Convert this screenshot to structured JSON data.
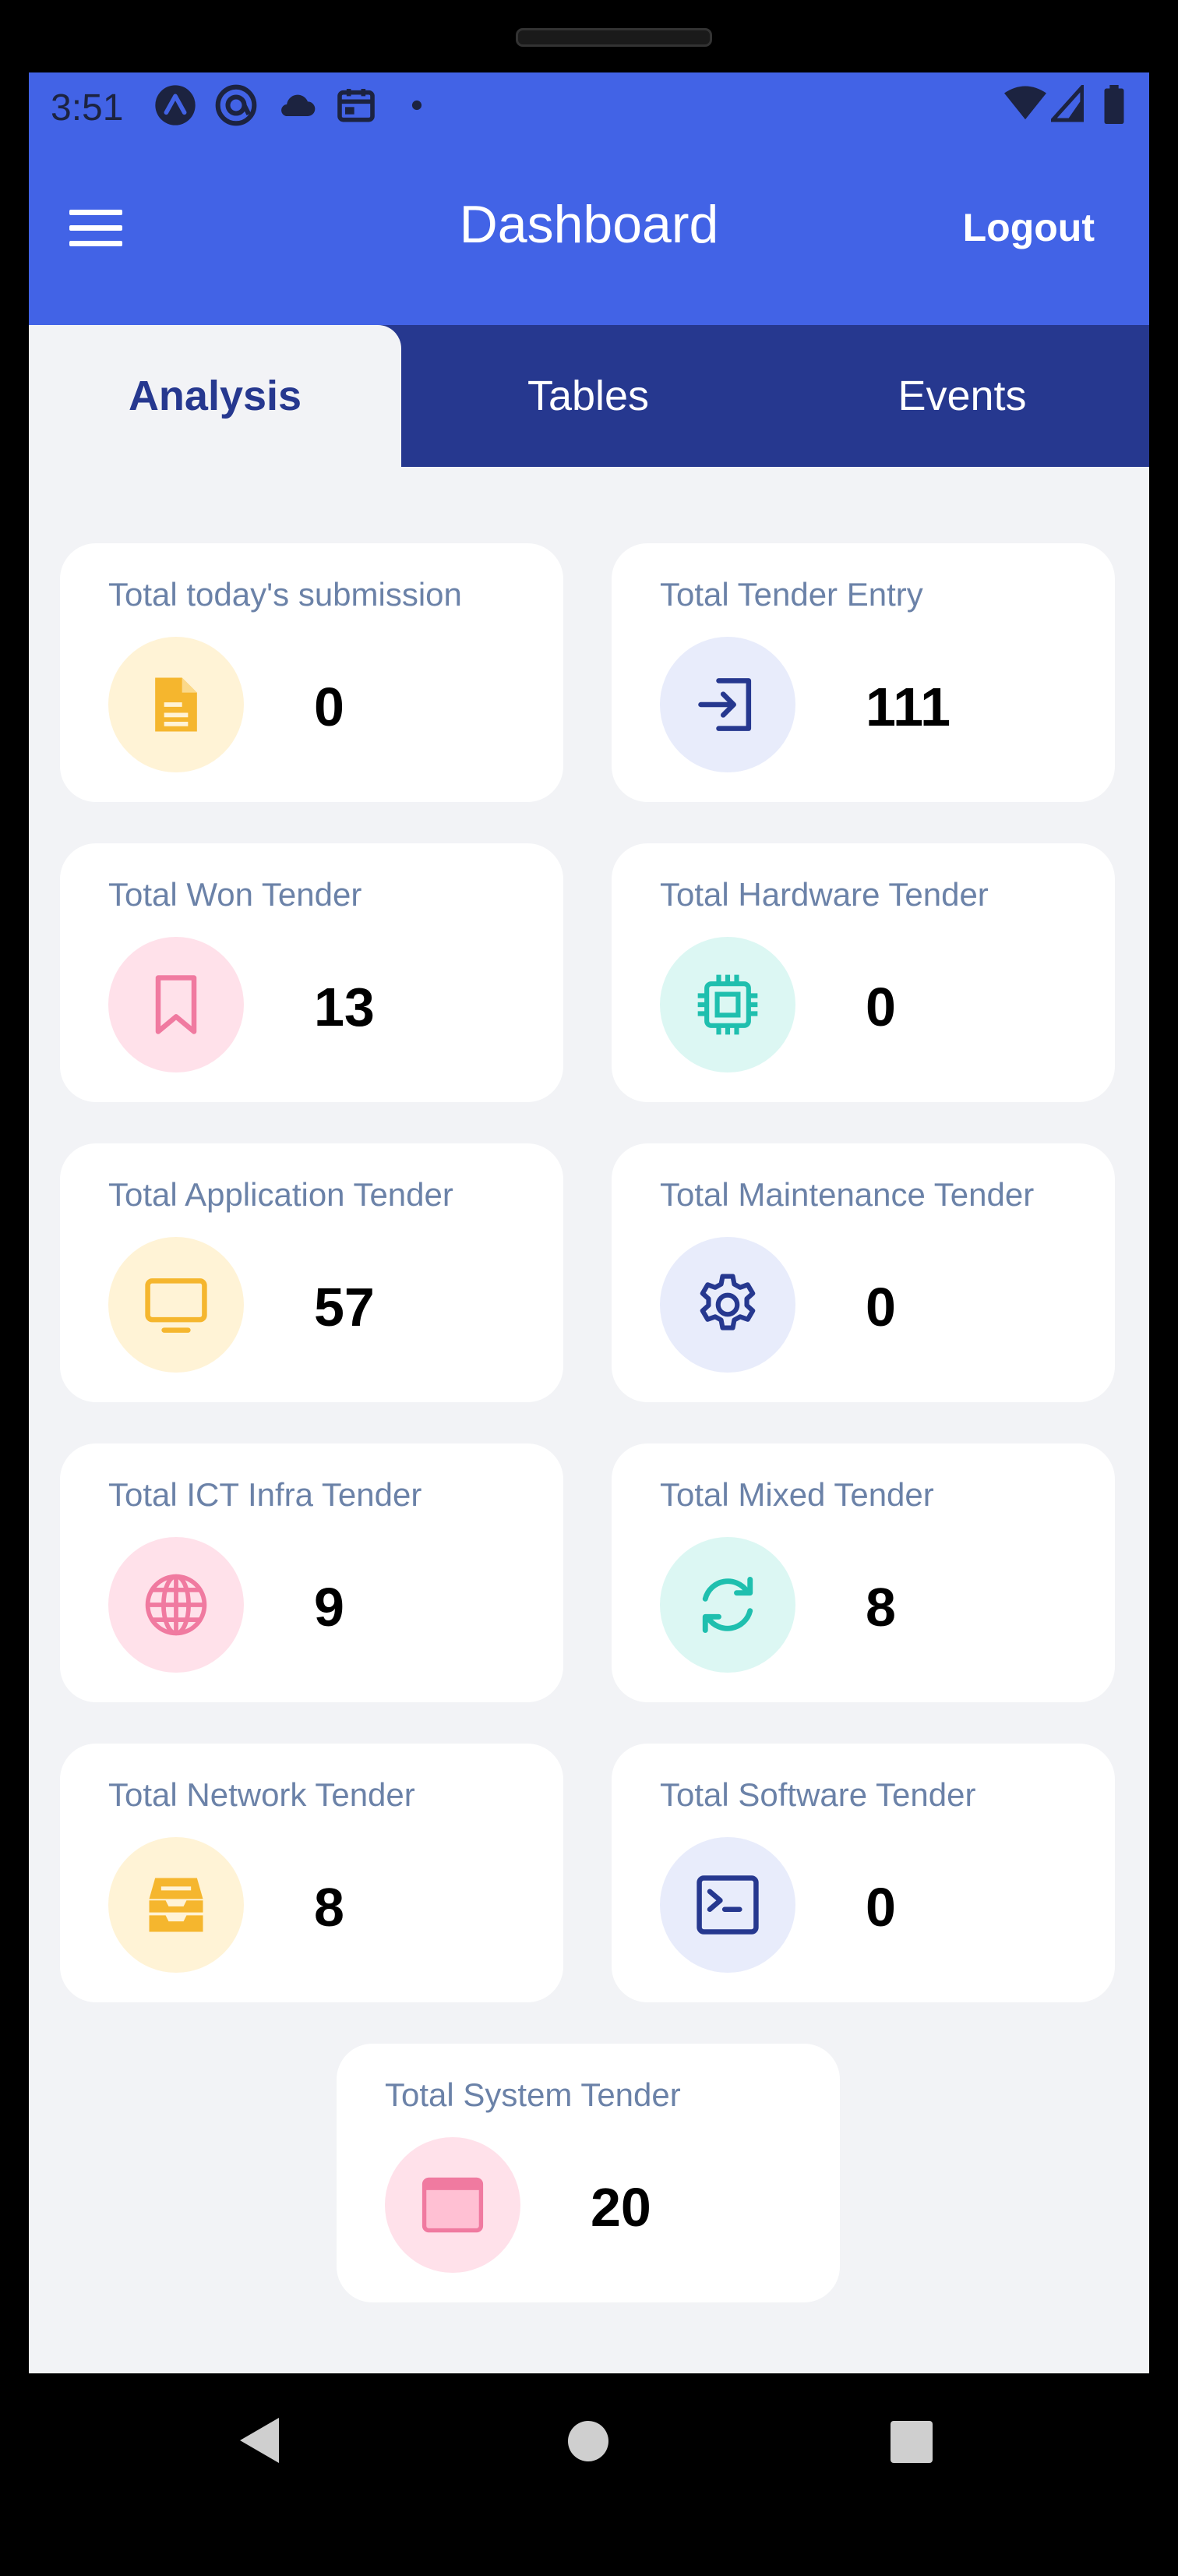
{
  "status_bar": {
    "time": "3:51",
    "left_icons": [
      "app-a-icon",
      "at-icon",
      "cloud-icon",
      "calendar-icon",
      "dot-icon"
    ],
    "right_icons": [
      "wifi-icon",
      "signal-icon",
      "battery-icon"
    ]
  },
  "header": {
    "title": "Dashboard",
    "logout_label": "Logout",
    "menu_icon": "hamburger-menu-icon",
    "color": "#4263e6"
  },
  "tabs": [
    {
      "label": "Analysis",
      "active": true
    },
    {
      "label": "Tables",
      "active": false
    },
    {
      "label": "Events",
      "active": false
    }
  ],
  "tab_bar_color": "#26388f",
  "cards": [
    {
      "label": "Total today's submission",
      "value": "0",
      "icon": "document-icon",
      "icon_color": "#f5b62e",
      "bg": "#fff3d6"
    },
    {
      "label": "Total Tender Entry",
      "value": "111",
      "icon": "sign-in-icon",
      "icon_color": "#26388f",
      "bg": "#e8ecfb"
    },
    {
      "label": "Total Won Tender",
      "value": "13",
      "icon": "bookmark-icon",
      "icon_color": "#f07aa0",
      "bg": "#ffe1ea"
    },
    {
      "label": "Total Hardware Tender",
      "value": "0",
      "icon": "chip-icon",
      "icon_color": "#1fbfae",
      "bg": "#dcf7f3"
    },
    {
      "label": "Total Application Tender",
      "value": "57",
      "icon": "monitor-icon",
      "icon_color": "#f5b62e",
      "bg": "#fff3d6"
    },
    {
      "label": "Total Maintenance Tender",
      "value": "0",
      "icon": "gear-icon",
      "icon_color": "#26388f",
      "bg": "#e8ecfb"
    },
    {
      "label": "Total ICT Infra Tender",
      "value": "9",
      "icon": "globe-icon",
      "icon_color": "#f07aa0",
      "bg": "#ffe1ea"
    },
    {
      "label": "Total Mixed Tender",
      "value": "8",
      "icon": "refresh-icon",
      "icon_color": "#1fbfae",
      "bg": "#dcf7f3"
    },
    {
      "label": "Total Network Tender",
      "value": "8",
      "icon": "inbox-icon",
      "icon_color": "#f5b62e",
      "bg": "#fff3d6"
    },
    {
      "label": "Total Software Tender",
      "value": "0",
      "icon": "terminal-icon",
      "icon_color": "#26388f",
      "bg": "#e8ecfb"
    },
    {
      "label": "Total System Tender",
      "value": "20",
      "icon": "window-icon",
      "icon_color": "#f07aa0",
      "bg": "#ffe1ea"
    }
  ],
  "nav_bar": {
    "icons": [
      "back-icon",
      "home-icon",
      "recents-icon"
    ]
  }
}
